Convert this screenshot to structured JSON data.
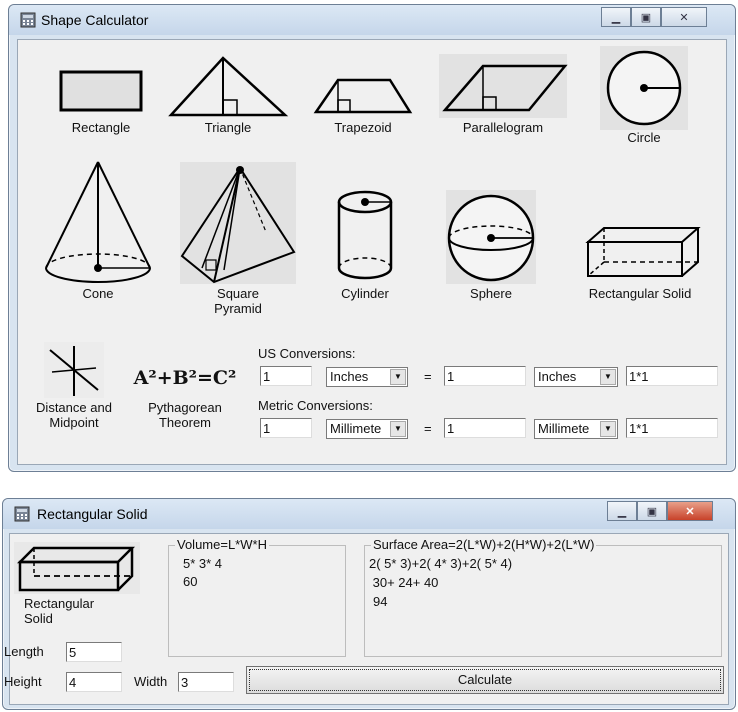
{
  "window1": {
    "title": "Shape Calculator",
    "shapes": [
      "Rectangle",
      "Triangle",
      "Trapezoid",
      "Parallelogram",
      "Circle",
      "Cone",
      "Square Pyramid",
      "Cylinder",
      "Sphere",
      "Rectangular Solid",
      "Distance and Midpoint",
      "Pythagorean Theorem"
    ],
    "pythagorean_formula": "A²+B²=C²",
    "us_label": "US Conversions:",
    "metric_label": "Metric Conversions:",
    "us": {
      "input": "1",
      "from_unit": "Inches",
      "equals": "=",
      "output": "1",
      "to_unit": "Inches",
      "factor": "1*1"
    },
    "metric": {
      "input": "1",
      "from_unit": "Millimete",
      "equals": "=",
      "output": "1",
      "to_unit": "Millimete",
      "factor": "1*1"
    }
  },
  "window2": {
    "title": "Rectangular Solid",
    "shape_label": "Rectangular Solid",
    "volume": {
      "label": "Volume=L*W*H",
      "lines": [
        "5* 3* 4",
        "60"
      ]
    },
    "surface": {
      "label": "Surface Area=2(L*W)+2(H*W)+2(L*W)",
      "lines": [
        "2( 5* 3)+2( 4* 3)+2( 5* 4)",
        " 30+ 24+ 40",
        "94"
      ]
    },
    "length_label": "Length",
    "length_value": "5",
    "height_label": "Height",
    "height_value": "4",
    "width_label": "Width",
    "width_value": "3",
    "calculate_label": "Calculate"
  }
}
